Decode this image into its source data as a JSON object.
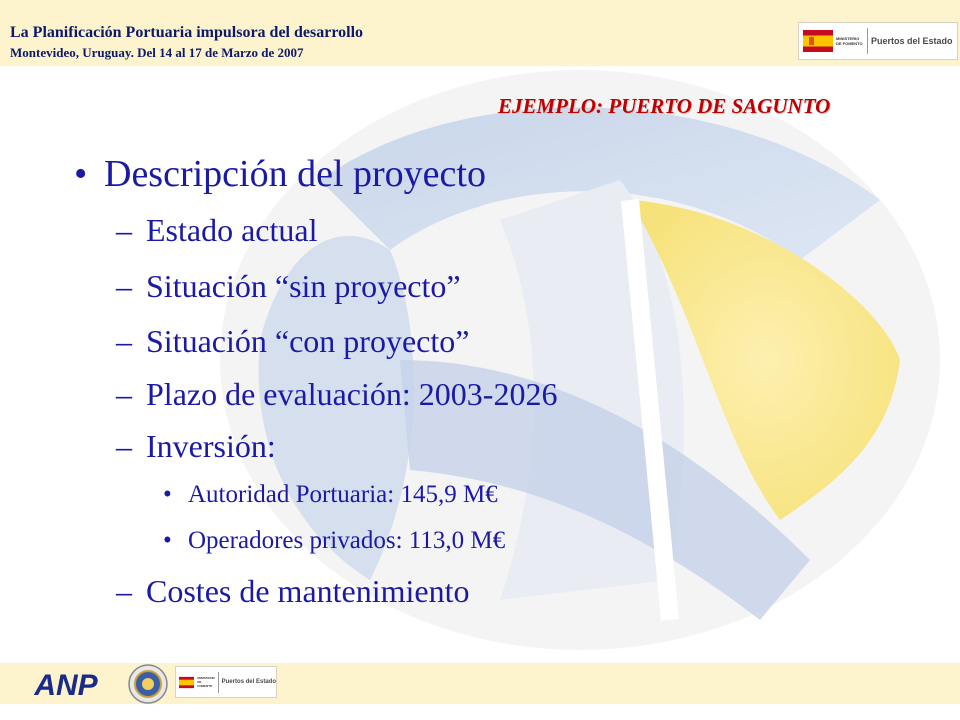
{
  "header": {
    "title": "La Planificación Portuaria impulsora del desarrollo",
    "subtitle": "Montevideo, Uruguay. Del 14 al 17 de Marzo de 2007",
    "logo_text": "Puertos del Estado",
    "ministry_text": "MINISTERIO DE FOMENTO"
  },
  "slide": {
    "example_title": "EJEMPLO: PUERTO DE SAGUNTO",
    "bullet_glyph": "•",
    "dash_glyph": "–",
    "heading": "Descripción del proyecto",
    "items": [
      "Estado actual",
      "Situación “sin proyecto”",
      "Situación “con proyecto”",
      "Plazo de evaluación: 2003-2026",
      "Inversión:"
    ],
    "sub_items": [
      "Autoridad Portuaria: 145,9 M€",
      "Operadores privados: 113,0 M€"
    ],
    "last_item": "Costes de mantenimiento"
  },
  "footer": {
    "anp_logo": "ANP",
    "logo_text": "Puertos del Estado",
    "ministry_text": "MINISTERIO DE FOMENTO"
  },
  "colors": {
    "navy": "#0d1a6b",
    "body_text": "#1a1aa6",
    "title_red": "#c00000",
    "band": "#fdf3cc"
  }
}
